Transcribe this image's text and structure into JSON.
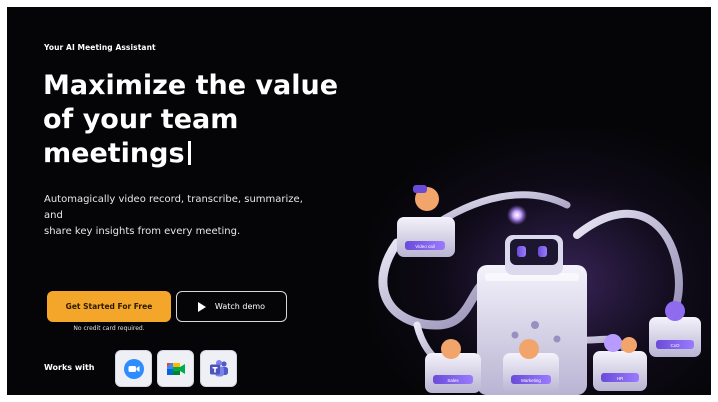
{
  "hero": {
    "eyebrow": "Your AI Meeting Assistant",
    "headline_lines": [
      "Maximize the value",
      "of your team",
      "meetings"
    ],
    "subtext_lines": [
      "Automagically video record, transcribe, summarize,",
      "and",
      "share key insights from every meeting."
    ]
  },
  "cta": {
    "primary_label": "Get Started For Free",
    "secondary_label": "Watch demo",
    "note": "No credit card required.",
    "primary_color": "#f4a62a"
  },
  "integrations": {
    "label": "Works with",
    "apps": [
      {
        "name": "Zoom",
        "icon": "zoom-icon"
      },
      {
        "name": "Google Meet",
        "icon": "google-meet-icon"
      },
      {
        "name": "Microsoft Teams",
        "icon": "microsoft-teams-icon"
      }
    ]
  },
  "illustration": {
    "labels": [
      "Video call",
      "Sales",
      "Marketing",
      "HR",
      "CxO"
    ],
    "accent": "#7b5cff"
  },
  "colors": {
    "background": "#050507",
    "text": "#ffffff"
  }
}
